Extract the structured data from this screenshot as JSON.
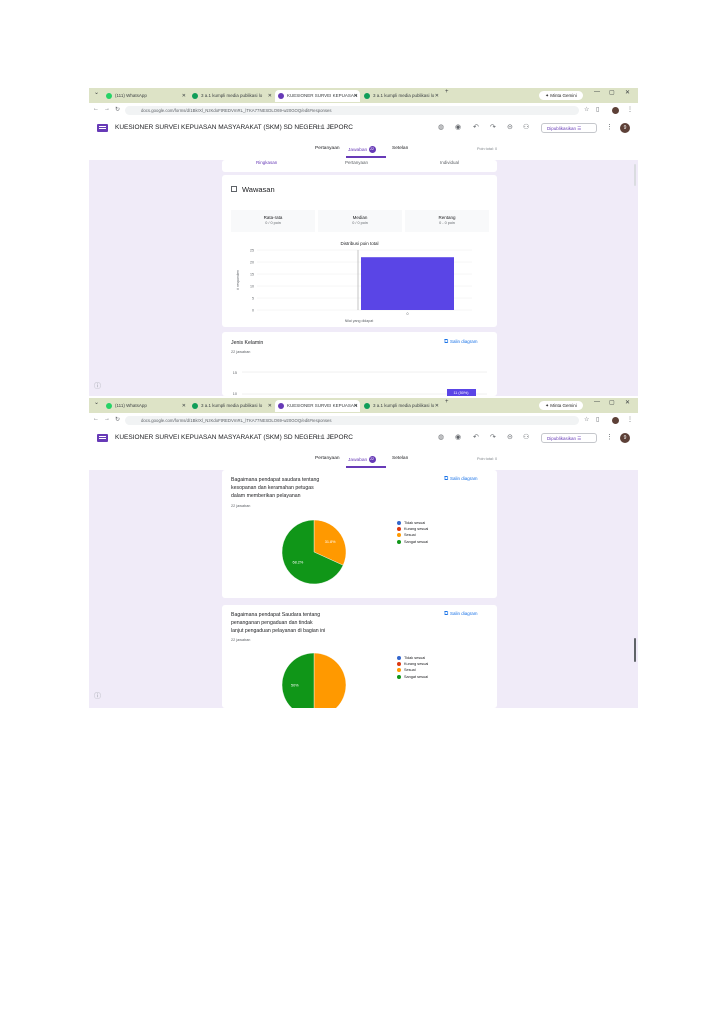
{
  "browser": {
    "tabs": [
      {
        "label": "(111) WhatsApp",
        "fav": "#25d366"
      },
      {
        "label": "3 a.1 kumpli media publikasi lo",
        "fav": "#0f9d58"
      },
      {
        "label": "KUESIONER SURVEI KEPUASAN",
        "fav": "#673ab7"
      },
      {
        "label": "3 a.1 kumpli media publikasi lo",
        "fav": "#0f9d58"
      }
    ],
    "new_tab": "+",
    "gemini_label": "✦ Minta Gemini",
    "url": "docs.google.com/forms/d/1BkrXl_NzKdoFtREDVmRL_lTKA77NESDLO69-w20GOQ/edit#responses",
    "window_controls": [
      "—",
      "▢",
      "✕"
    ]
  },
  "form": {
    "title": "KUESIONER SURVEI KEPUASAN MASYARAKAT (SKM) SD NEGERI 1 JEPORC",
    "publish_label": "Dipublikasikan",
    "avatar_letter": "9",
    "tabs": [
      "Pertanyaan",
      "Jawaban",
      "Setelan"
    ],
    "responses_count": "22",
    "points_total": "Poin total: 0"
  },
  "subtabs": [
    "Ringkasan",
    "Pertanyaan",
    "Individual"
  ],
  "insights": {
    "title": "Wawasan",
    "stats": [
      {
        "label": "Rata-rata",
        "value": "0 / 0 poin"
      },
      {
        "label": "Median",
        "value": "0 / 0 poin"
      },
      {
        "label": "Rentang",
        "value": "0 - 0 poin"
      }
    ],
    "chart_title": "Distribusi poin total",
    "chart_data": {
      "type": "bar",
      "title": "Distribusi poin total",
      "xlabel": "Nilai yang didapat",
      "ylabel": "# responden",
      "categories": [
        "0"
      ],
      "values": [
        22
      ],
      "ylim": [
        0,
        25
      ],
      "yticks": [
        "25",
        "20",
        "15",
        "10",
        "5",
        "0"
      ],
      "xtick": "0",
      "color": "#5a45e6"
    }
  },
  "gender_question": {
    "title": "Jenis Kelamin",
    "responses": "22 jawaban",
    "copy_label": "Salin diagram",
    "axis_tick_15": "15",
    "axis_tick_10": "10",
    "bar_label": "11 (50%)"
  },
  "pie_questions": [
    {
      "title_lines": [
        "Bagaimana pendapat saudara tentang",
        "kesopanan dan keramahan petugas",
        "dalam memberikan pelayanan"
      ],
      "responses": "22 jawaban",
      "copy_label": "Salin diagram",
      "chart_data": {
        "type": "pie",
        "labels": [
          "Tidak sesuai",
          "Kurang sesuai",
          "Sesuai",
          "Sangat sesuai"
        ],
        "values": [
          0,
          0,
          31.8,
          68.2
        ],
        "colors": [
          "#3366cc",
          "#dc3912",
          "#ff9900",
          "#109618"
        ],
        "slice_labels": [
          "",
          "",
          "31.8%",
          "68.2%"
        ]
      }
    },
    {
      "title_lines": [
        "Bagaimana pendapat Saudara tentang",
        "penanganan pengaduan dan tindak",
        "lanjut pengaduan pelayanan di bagian ini"
      ],
      "responses": "22 jawaban",
      "copy_label": "Salin diagram",
      "chart_data": {
        "type": "pie",
        "labels": [
          "Tidak sesuai",
          "Kurang sesuai",
          "Sesuai",
          "Sangat sesuai"
        ],
        "values": [
          0,
          0,
          50,
          50
        ],
        "colors": [
          "#3366cc",
          "#dc3912",
          "#ff9900",
          "#109618"
        ],
        "slice_labels": [
          "",
          "",
          "",
          "50%"
        ]
      }
    }
  ],
  "icons": {
    "help": "?",
    "star": "☆",
    "folder": "▭",
    "palette": "◍",
    "preview": "◉",
    "undo": "↶",
    "redo": "↷",
    "link": "⊝",
    "add_person": "⚇",
    "more": "⋮"
  }
}
